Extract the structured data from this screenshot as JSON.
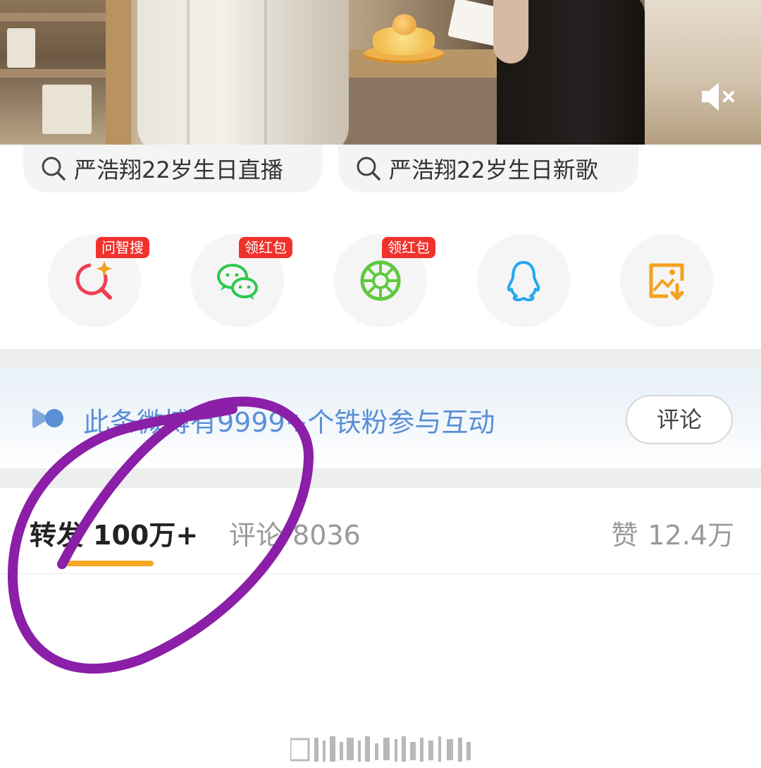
{
  "video": {
    "mute_icon": "volume-muted-icon"
  },
  "search_suggestions": [
    {
      "text": "严浩翔22岁生日直播",
      "icon": "search-icon"
    },
    {
      "text": "严浩翔22岁生日新歌",
      "icon": "search-icon"
    }
  ],
  "share_row": [
    {
      "icon": "ai-search-icon",
      "badge": "问智搜",
      "color": "#ef3f52"
    },
    {
      "icon": "wechat-icon",
      "badge": "领红包",
      "color": "#2dc84d"
    },
    {
      "icon": "moments-icon",
      "badge": "领红包",
      "color": "#5fc93f"
    },
    {
      "icon": "qq-icon",
      "badge": "",
      "color": "#25a7f0"
    },
    {
      "icon": "save-image-icon",
      "badge": "",
      "color": "#f4a11d"
    }
  ],
  "fans_banner": {
    "text": "此条微博有9999+个铁粉参与互动",
    "button": "评论",
    "text_color": "#5a8fd6"
  },
  "tabs": {
    "repost": {
      "label": "转发",
      "count": "100万+"
    },
    "comment": {
      "label": "评论",
      "count": "8036"
    },
    "like": {
      "label": "赞",
      "count": "12.4万"
    }
  },
  "colors": {
    "accent_underline": "#f5a623",
    "annotation": "#8b1fa8",
    "badge_red": "#f0322d"
  }
}
